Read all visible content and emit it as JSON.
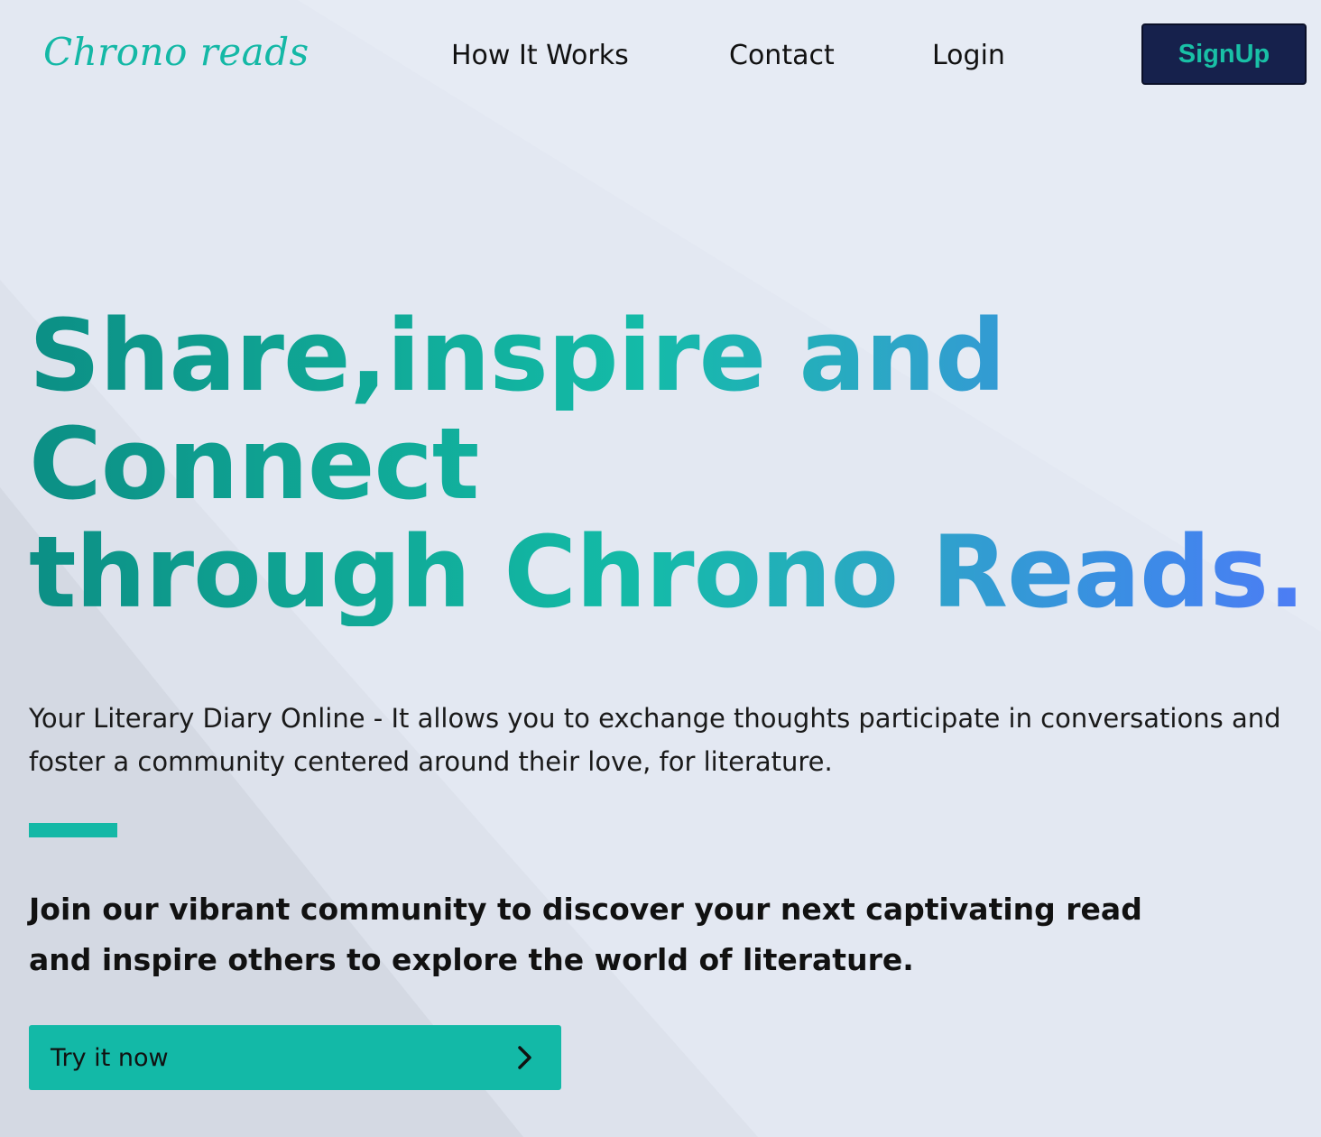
{
  "nav": {
    "logo": "Chrono reads",
    "links": [
      {
        "label": "How It Works"
      },
      {
        "label": "Contact"
      },
      {
        "label": "Login"
      }
    ],
    "signup_label": "SignUp"
  },
  "hero": {
    "headline_lines": [
      "Share,inspire and",
      "Connect",
      "through Chrono Reads."
    ],
    "description": "Your Literary Diary Online - It allows you to exchange thoughts participate in conversations and foster a community centered around their love, for literature.",
    "join_lines": [
      "Join our vibrant community to discover your next captivating read",
      "and inspire others to explore the world of literature."
    ],
    "cta_label": "Try it now",
    "cta_icon": "chevron-right-icon"
  },
  "colors": {
    "accent": "#14b8a6",
    "signup_bg": "#16214c",
    "background": "#e3e8f2",
    "gradient_end": "#4e7cf5"
  }
}
